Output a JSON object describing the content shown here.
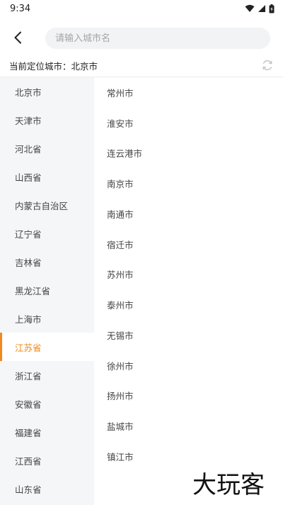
{
  "status_bar": {
    "time": "9:34"
  },
  "search": {
    "placeholder": "请输入城市名"
  },
  "location": {
    "label": "当前定位城市：北京市"
  },
  "provinces": [
    {
      "name": "北京市",
      "active": false
    },
    {
      "name": "天津市",
      "active": false
    },
    {
      "name": "河北省",
      "active": false
    },
    {
      "name": "山西省",
      "active": false
    },
    {
      "name": "内蒙古自治区",
      "active": false
    },
    {
      "name": "辽宁省",
      "active": false
    },
    {
      "name": "吉林省",
      "active": false
    },
    {
      "name": "黑龙江省",
      "active": false
    },
    {
      "name": "上海市",
      "active": false
    },
    {
      "name": "江苏省",
      "active": true
    },
    {
      "name": "浙江省",
      "active": false
    },
    {
      "name": "安徽省",
      "active": false
    },
    {
      "name": "福建省",
      "active": false
    },
    {
      "name": "江西省",
      "active": false
    },
    {
      "name": "山东省",
      "active": false
    }
  ],
  "cities": [
    "常州市",
    "淮安市",
    "连云港市",
    "南京市",
    "南通市",
    "宿迁市",
    "苏州市",
    "泰州市",
    "无锡市",
    "徐州市",
    "扬州市",
    "盐城市",
    "镇江市"
  ],
  "colors": {
    "accent": "#f08a1c",
    "sidebar_bg": "#f5f6f8",
    "search_bg": "#f2f3f5"
  },
  "icons": {
    "back": "chevron-left-icon",
    "refresh": "refresh-icon",
    "wifi": "wifi-icon",
    "signal": "signal-icon",
    "battery": "battery-icon"
  },
  "watermark": {
    "text": "大玩客"
  }
}
